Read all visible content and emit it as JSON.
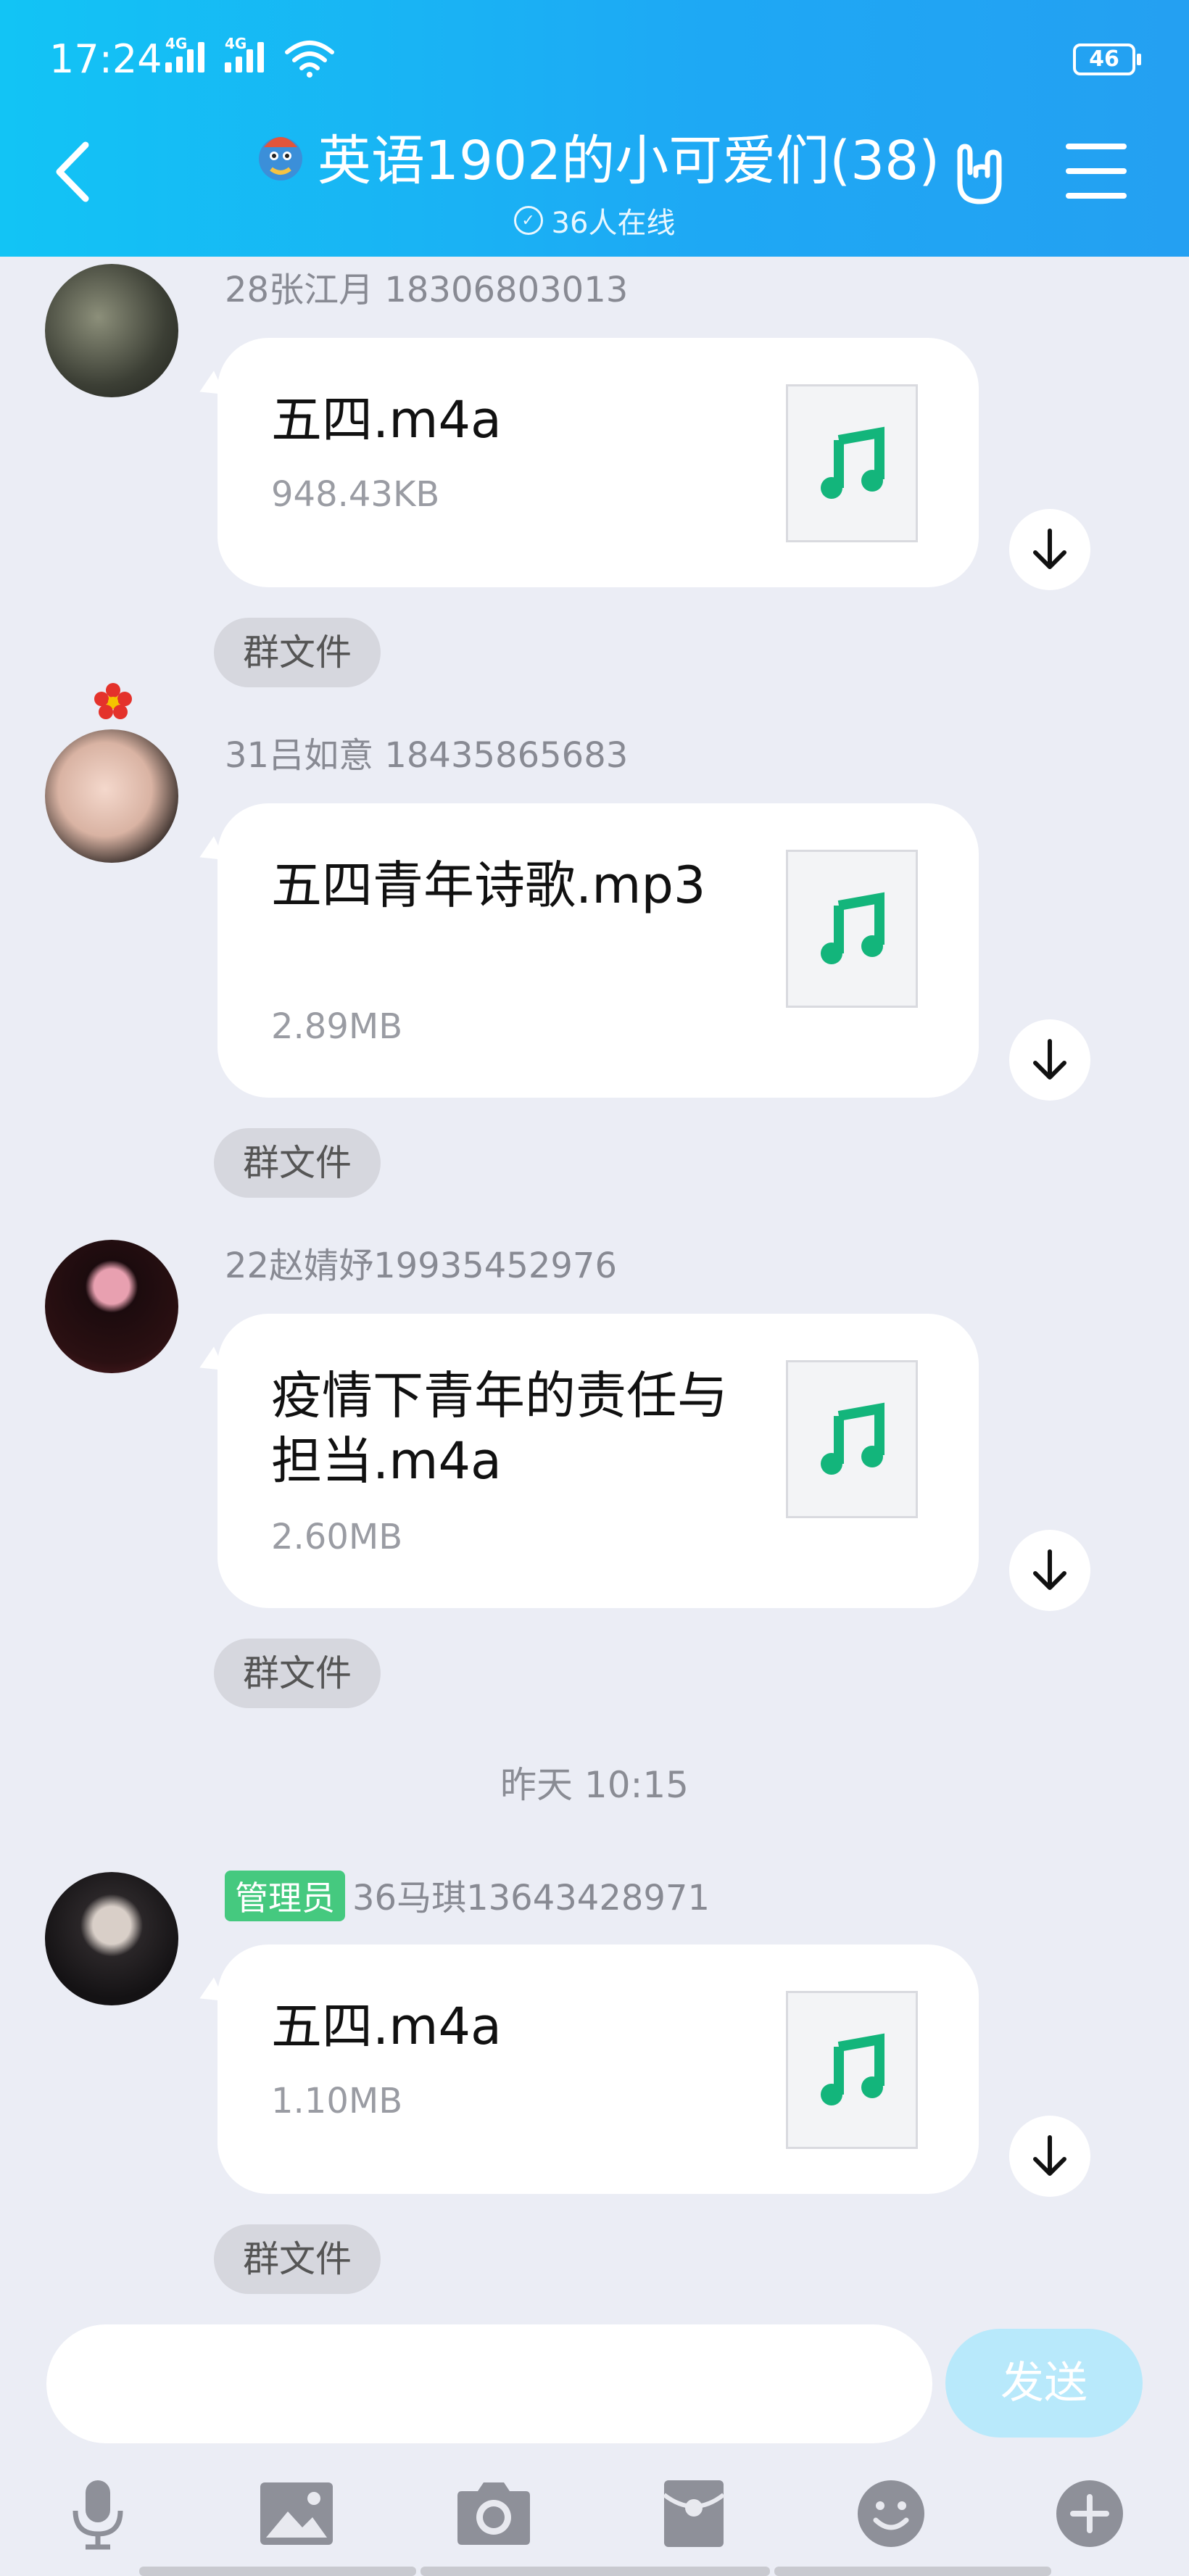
{
  "status_bar": {
    "time": "17:24",
    "net1": "4G",
    "net2": "4G",
    "battery": "46"
  },
  "header": {
    "title": "英语1902的小可爱们(38)",
    "online_text": "36人在线",
    "accent_color": "#1ea8f4",
    "icons": [
      "back-arrow-icon",
      "dragon-avatar-icon",
      "rock-hand-icon",
      "menu-icon"
    ]
  },
  "messages": [
    {
      "sender": "28张江月 18306803013",
      "file_name": "五四.m4a",
      "file_size": "948.43KB",
      "tag": "群文件",
      "admin": false
    },
    {
      "sender": "31吕如意 18435865683",
      "file_name": "五四青年诗歌.mp3",
      "file_size": "2.89MB",
      "tag": "群文件",
      "admin": false
    },
    {
      "sender": "22赵婧妤19935452976",
      "file_name": "疫情下青年的责任与担当.m4a",
      "file_size": "2.60MB",
      "tag": "群文件",
      "admin": false
    },
    {
      "sender": "36马琪13643428971",
      "admin_badge": "管理员",
      "file_name": "五四.m4a",
      "file_size": "1.10MB",
      "tag": "群文件",
      "admin": true
    }
  ],
  "timestamp": "昨天 10:15",
  "input": {
    "value": "",
    "send_label": "发送"
  },
  "toolbar": {
    "icons": [
      "microphone-icon",
      "image-icon",
      "camera-icon",
      "red-packet-icon",
      "emoji-icon",
      "plus-icon"
    ]
  }
}
